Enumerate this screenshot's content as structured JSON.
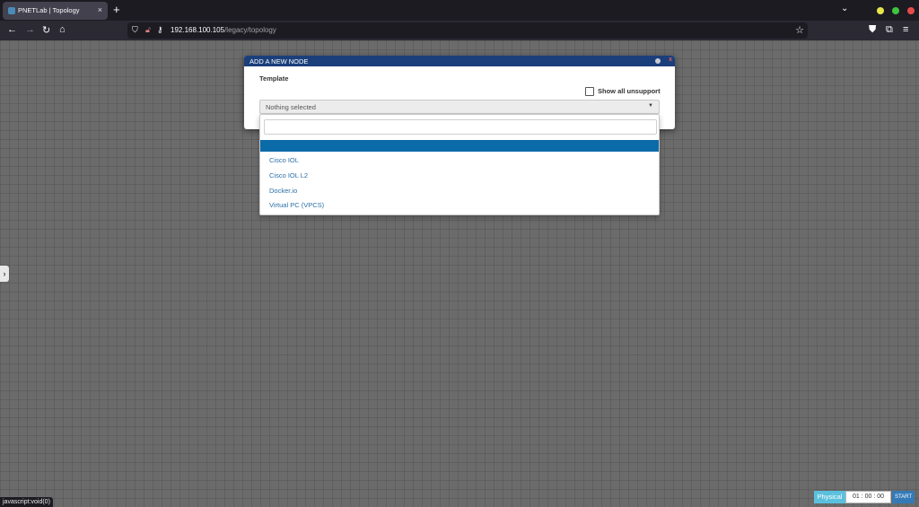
{
  "browser": {
    "tab_title": "PNETLab | Topology",
    "tab_close": "×",
    "new_tab": "+",
    "url_host": "192.168.100.105",
    "url_path": "/legacy/topology",
    "status_text": "javascript:void(0)"
  },
  "modal": {
    "title": "ADD A NEW NODE",
    "close_glyph": "x",
    "template_label": "Template",
    "show_all_label": "Show all unsupport",
    "select_value": "Nothing selected"
  },
  "dropdown": {
    "search_value": "",
    "options": [
      "Cisco IOL",
      "Cisco IOL L2",
      "Docker.io",
      "Virtual PC (VPCS)"
    ]
  },
  "controls": {
    "physical_label": "Physical",
    "timer": "01 : 00 : 00",
    "start_label": "START"
  },
  "colors": {
    "modal_header": "#1b3f7a",
    "highlight": "#0b6aa8",
    "physical": "#5bc0de",
    "start": "#337ab7"
  }
}
